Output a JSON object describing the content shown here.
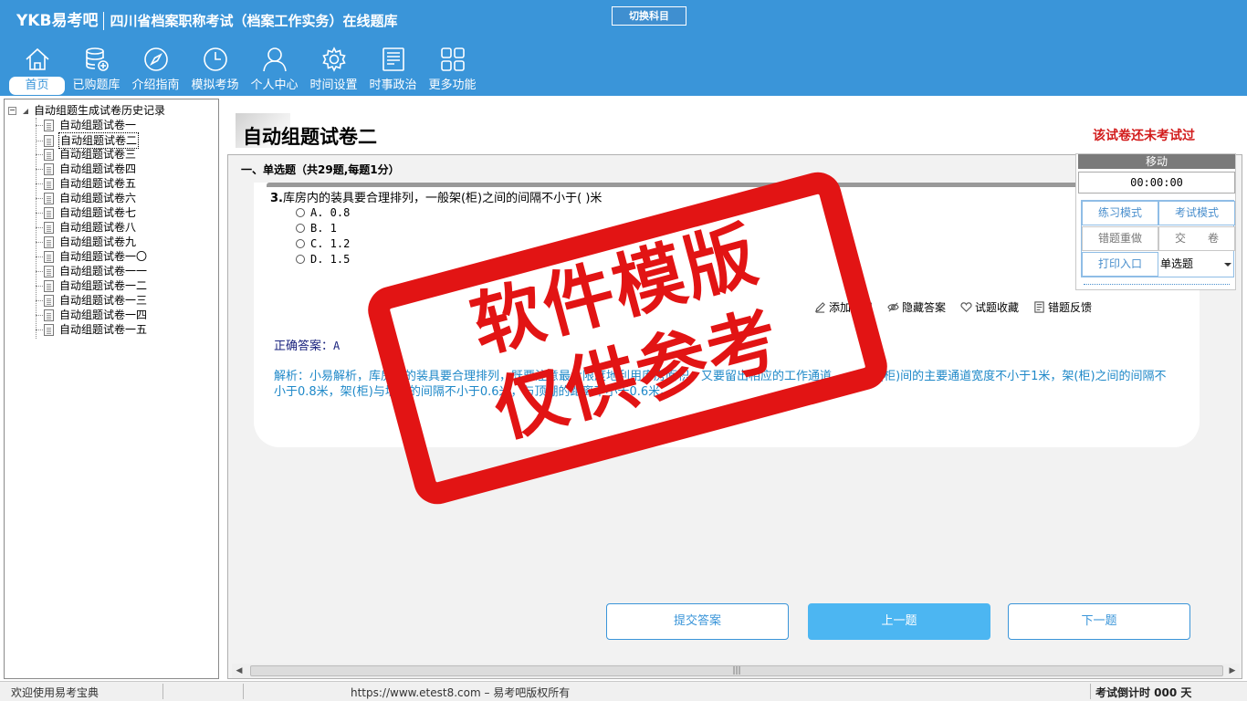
{
  "app": {
    "brand": "YKB易考吧",
    "subtitle": "四川省档案职称考试（档案工作实务）在线题库",
    "switch_subject": "切换科目"
  },
  "nav": [
    {
      "label": "首页",
      "icon": "home-icon",
      "active": true
    },
    {
      "label": "已购题库",
      "icon": "database-icon"
    },
    {
      "label": "介绍指南",
      "icon": "compass-icon"
    },
    {
      "label": "模拟考场",
      "icon": "clock-icon"
    },
    {
      "label": "个人中心",
      "icon": "user-icon"
    },
    {
      "label": "时间设置",
      "icon": "gear-icon"
    },
    {
      "label": "时事政治",
      "icon": "newspaper-icon"
    },
    {
      "label": "更多功能",
      "icon": "grid-icon"
    }
  ],
  "tree": {
    "root": "自动组题生成试卷历史记录",
    "items": [
      "自动组题试卷一",
      "自动组题试卷二",
      "自动组题试卷三",
      "自动组题试卷四",
      "自动组题试卷五",
      "自动组题试卷六",
      "自动组题试卷七",
      "自动组题试卷八",
      "自动组题试卷九",
      "自动组题试卷一〇",
      "自动组题试卷一一",
      "自动组题试卷一二",
      "自动组题试卷一三",
      "自动组题试卷一四",
      "自动组题试卷一五"
    ],
    "selected_index": 1
  },
  "paper": {
    "title": "自动组题试卷二",
    "status": "该试卷还未考试过",
    "section": "一、单选题（共29题,每题1分）"
  },
  "question": {
    "number": "3.",
    "text": "库房内的装具要合理排列，一般架(柜)之间的间隔不小于(  )米",
    "options": [
      "A. 0.8",
      "B. 1",
      "C. 1.2",
      "D. 1.5"
    ]
  },
  "tools": [
    {
      "label": "添加笔记",
      "icon": "pencil-icon"
    },
    {
      "label": "隐藏答案",
      "icon": "eye-icon"
    },
    {
      "label": "试题收藏",
      "icon": "heart-icon"
    },
    {
      "label": "错题反馈",
      "icon": "feedback-icon"
    }
  ],
  "answer": {
    "label": "正确答案：",
    "value": "A"
  },
  "analysis": "解析：小易解析，库房内的装具要合理排列，既要注意最大限度地利用库房面积，又要留出相应的工作通道。一般架(柜)间的主要通道宽度不小于1米，架(柜)之间的间隔不小于0.8米，架(柜)与墙壁的间隔不小于0.6米，与顶棚的距离不小于0.6米。",
  "buttons": {
    "submit": "提交答案",
    "prev": "上一题",
    "next": "下一题"
  },
  "panel": {
    "drag": "移动",
    "timer": "00:00:00",
    "practice": "练习模式",
    "exam": "考试模式",
    "redo": "错题重做",
    "submit": "交　　卷",
    "print": "打印入口",
    "type": "单选题"
  },
  "watermark": {
    "line1": "软件模版",
    "line2": "仅供参考"
  },
  "statusbar": {
    "welcome": "欢迎使用易考宝典",
    "copyright": "https://www.etest8.com – 易考吧版权所有",
    "countdown": "考试倒计时 000 天"
  },
  "colors": {
    "header": "#3a95d9",
    "accent": "#4cb6f2",
    "status_red": "#d21c1c",
    "analysis_blue": "#1e88c8",
    "stamp_red": "#e21414"
  }
}
